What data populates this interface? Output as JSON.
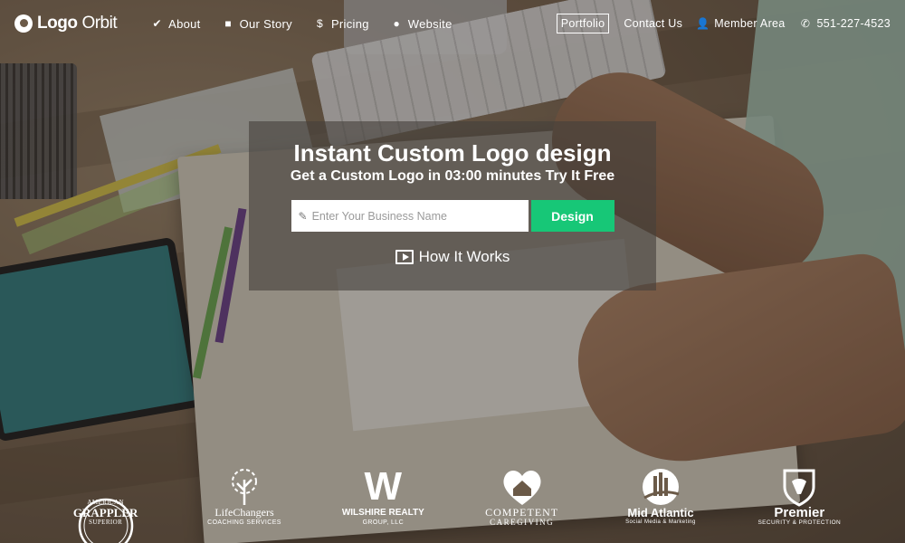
{
  "brand": {
    "name_bold": "Logo",
    "name_rest": "Orbit"
  },
  "nav": {
    "left": [
      {
        "label": "About",
        "icon": "check-circle-icon"
      },
      {
        "label": "Our Story",
        "icon": "video-camera-icon"
      },
      {
        "label": "Pricing",
        "icon": "dollar-icon"
      },
      {
        "label": "Website",
        "icon": "globe-icon"
      }
    ],
    "right": {
      "portfolio": "Portfolio",
      "contact": "Contact Us",
      "member": "Member Area",
      "phone": "551-227-4523"
    }
  },
  "hero": {
    "title": "Instant Custom Logo design",
    "subtitle": "Get a Custom Logo in 03:00 minutes Try It Free",
    "input_placeholder": "Enter Your Business Name",
    "input_value": "",
    "design_label": "Design",
    "how_label": "How It Works",
    "accent": "#17c777"
  },
  "clients": [
    {
      "line1": "AMERICAN",
      "name": "GRAPPLER",
      "tag": "SUPERIOR"
    },
    {
      "line1": "",
      "name": "LifeChangers",
      "tag": "COACHING SERVICES"
    },
    {
      "line1": "W",
      "name": "WILSHIRE REALTY",
      "tag": "GROUP, LLC"
    },
    {
      "line1": "",
      "name": "COMPETENT",
      "tag": "CAREGIVING"
    },
    {
      "line1": "",
      "name": "Mid Atlantic",
      "tag": "Social Media & Marketing"
    },
    {
      "line1": "",
      "name": "Premier",
      "tag": "SECURITY & PROTECTION"
    }
  ]
}
